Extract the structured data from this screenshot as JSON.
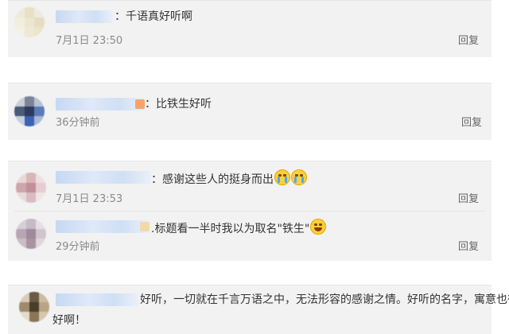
{
  "comments": [
    {
      "text": "：千语真好听啊",
      "time": "7月1日 23:50",
      "reply": "回复",
      "avatar_colors": [
        "#efe9d9",
        "#e8dfc6",
        "#efeadf",
        "#f1eedc",
        "#ebe6cf",
        "#e6dcc2",
        "#f3f0e6",
        "#eee8d5",
        "#ece5cc"
      ]
    },
    {
      "text": "：比铁生好听",
      "time": "36分钟前",
      "reply": "回复",
      "accent": "#f7a46b",
      "avatar_colors": [
        "#c9cfd8",
        "#7b8598",
        "#b8c2d4",
        "#4a5a78",
        "#2c3a5c",
        "#5a7bb6",
        "#c6cde0",
        "#3b62b4",
        "#aab8d6"
      ]
    },
    {
      "text": "：感谢这些人的挺身而出",
      "time": "7月1日 23:53",
      "reply": "回复",
      "emoji": [
        "crying-face-icon",
        "crying-face-icon"
      ],
      "avatar_colors": [
        "#e8d8d8",
        "#d9b6b6",
        "#efe0e0",
        "#cfa5ad",
        "#c18f99",
        "#e6cdd1",
        "#eadada",
        "#d8bcc2",
        "#f0e4e4"
      ]
    },
    {
      "text": ".标题看一半时我以为取名\"铁生\"",
      "time": "29分钟前",
      "reply": "回复",
      "emoji": [
        "laughing-face-icon"
      ],
      "accent": "#f2d9a6",
      "avatar_colors": [
        "#d8cfd6",
        "#c7b9c5",
        "#e6dfe4",
        "#b8a6b6",
        "#9d8a9a",
        "#d2c4cf",
        "#cbbdc8",
        "#a8939f",
        "#e0d6dc"
      ]
    },
    {
      "text_line1": "好听，一切就在千言万语之中，无法形容的感谢之情。好听的名字，寓意也很",
      "text_line2": "好啊！",
      "avatar_colors": [
        "#d8ccb8",
        "#6b5a44",
        "#cbbba2",
        "#a08a6c",
        "#4a3c2a",
        "#b9a586",
        "#e4dbcb",
        "#8a7558",
        "#d5c7ad"
      ]
    }
  ]
}
